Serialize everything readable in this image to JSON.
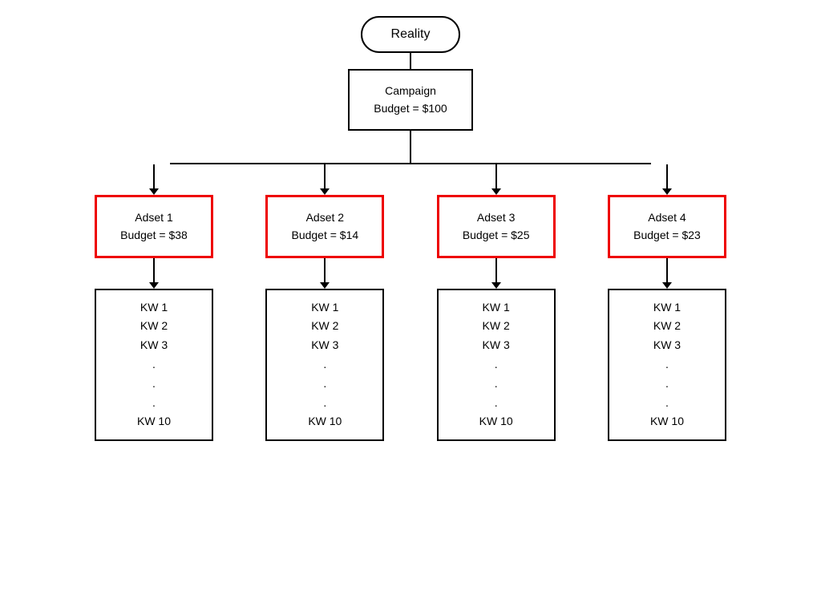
{
  "reality": {
    "label": "Reality"
  },
  "campaign": {
    "line1": "Campaign",
    "line2": "Budget = $100"
  },
  "adsets": [
    {
      "line1": "Adset 1",
      "line2": "Budget = $38"
    },
    {
      "line1": "Adset 2",
      "line2": "Budget = $14"
    },
    {
      "line1": "Adset 3",
      "line2": "Budget = $25"
    },
    {
      "line1": "Adset 4",
      "line2": "Budget = $23"
    }
  ],
  "kw_nodes": [
    {
      "items": [
        "KW 1",
        "KW 2",
        "KW 3",
        ".",
        ".",
        ".",
        "KW 10"
      ]
    },
    {
      "items": [
        "KW 1",
        "KW 2",
        "KW 3",
        ".",
        ".",
        ".",
        "KW 10"
      ]
    },
    {
      "items": [
        "KW 1",
        "KW 2",
        "KW 3",
        ".",
        ".",
        ".",
        "KW 10"
      ]
    },
    {
      "items": [
        "KW 1",
        "KW 2",
        "KW 3",
        ".",
        ".",
        ".",
        "KW 10"
      ]
    }
  ]
}
